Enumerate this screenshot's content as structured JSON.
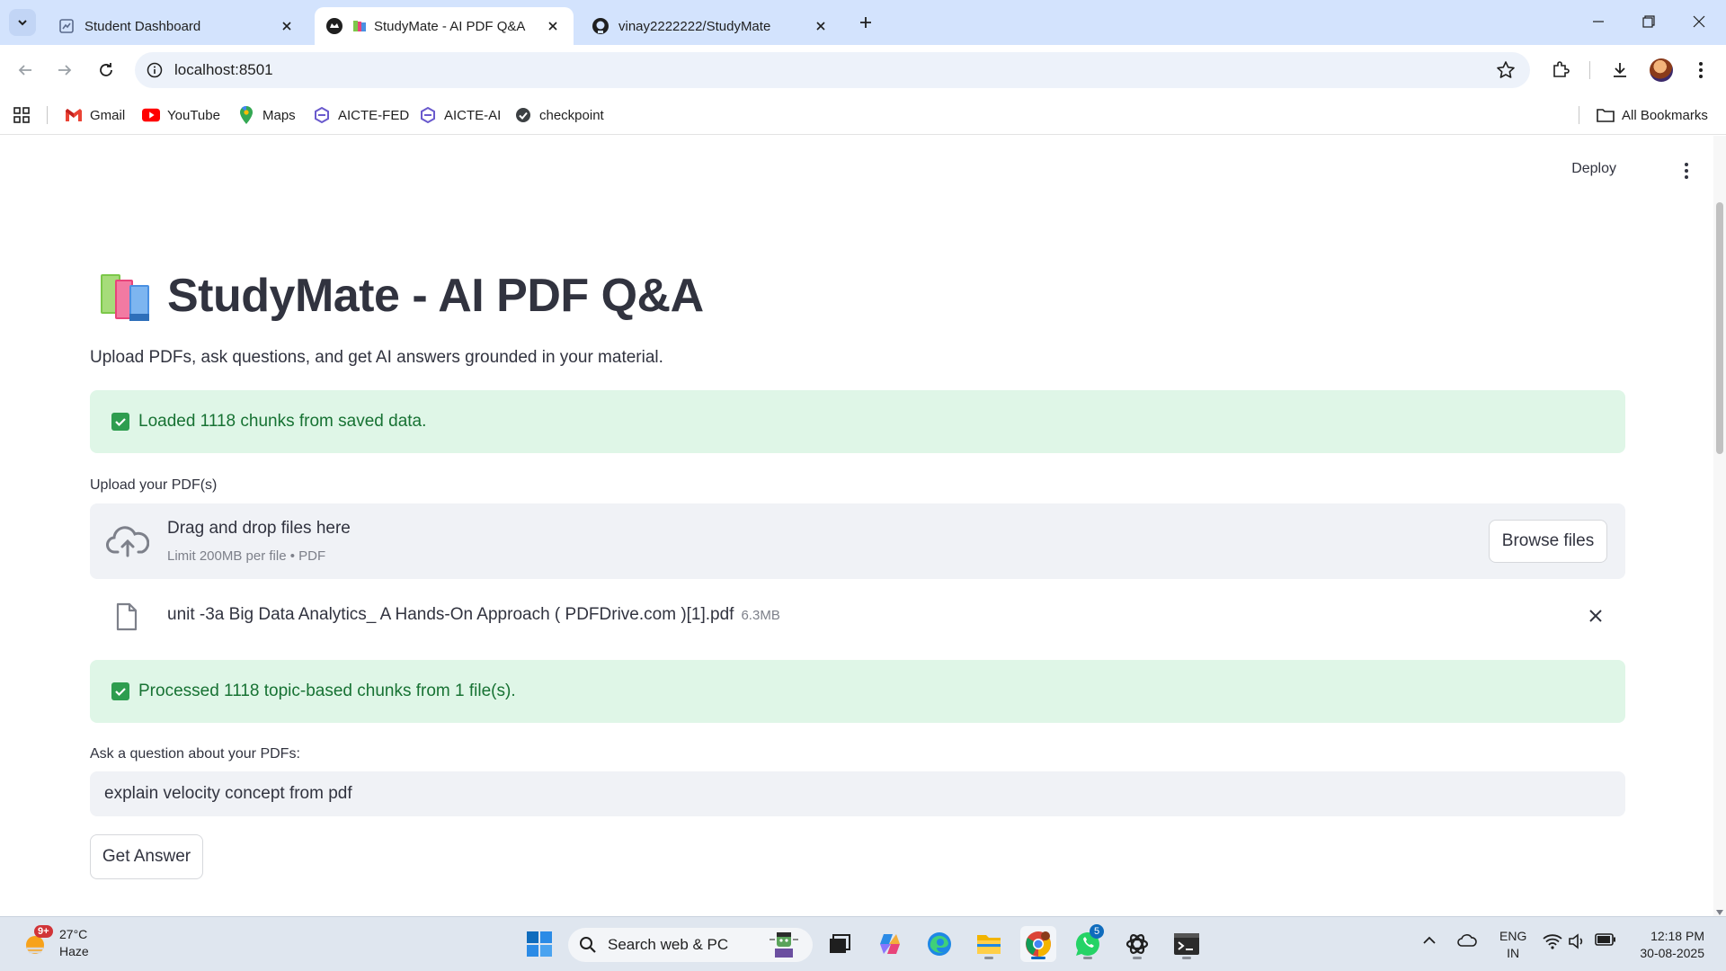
{
  "browser": {
    "tabs": [
      {
        "title": "Student Dashboard",
        "active": false
      },
      {
        "title": "StudyMate - AI PDF Q&A",
        "active": true
      },
      {
        "title": "vinay2222222/StudyMate",
        "active": false
      }
    ],
    "url": "localhost:8501",
    "bookmarks": [
      {
        "label": "Gmail",
        "icon": "gmail-icon"
      },
      {
        "label": "YouTube",
        "icon": "youtube-icon"
      },
      {
        "label": "Maps",
        "icon": "maps-icon"
      },
      {
        "label": "AICTE-FED",
        "icon": "aicte-icon"
      },
      {
        "label": "AICTE-AI",
        "icon": "aicte-icon"
      },
      {
        "label": "checkpoint",
        "icon": "checkpoint-icon"
      }
    ],
    "all_bookmarks": "All Bookmarks"
  },
  "app": {
    "deploy_label": "Deploy",
    "title": "StudyMate - AI PDF Q&A",
    "title_icon": "books-icon",
    "subtitle": "Upload PDFs, ask questions, and get AI answers grounded in your material.",
    "loaded_message": "Loaded 1118 chunks from saved data.",
    "upload_label": "Upload your PDF(s)",
    "dropzone": {
      "primary": "Drag and drop files here",
      "secondary": "Limit 200MB per file • PDF",
      "browse_label": "Browse files"
    },
    "uploaded_file": {
      "name": "unit -3a Big Data Analytics_ A Hands-On Approach ( PDFDrive.com )[1].pdf",
      "size": "6.3MB"
    },
    "processed_message": "Processed 1118 topic-based chunks from 1 file(s).",
    "question_label": "Ask a question about your PDFs:",
    "question_value": "explain velocity concept from pdf",
    "submit_label": "Get Answer"
  },
  "taskbar": {
    "weather_temp": "27°C",
    "weather_desc": "Haze",
    "weather_badge": "9+",
    "search_placeholder": "Search web & PC",
    "whatsapp_badge": "5",
    "lang_line1": "ENG",
    "lang_line2": "IN",
    "time": "12:18 PM",
    "date": "30-08-2025"
  },
  "colors": {
    "success_bg": "#dff6e7",
    "success_text": "#177233",
    "accent": "#0067c0",
    "tabstrip": "#d3e3fd"
  }
}
